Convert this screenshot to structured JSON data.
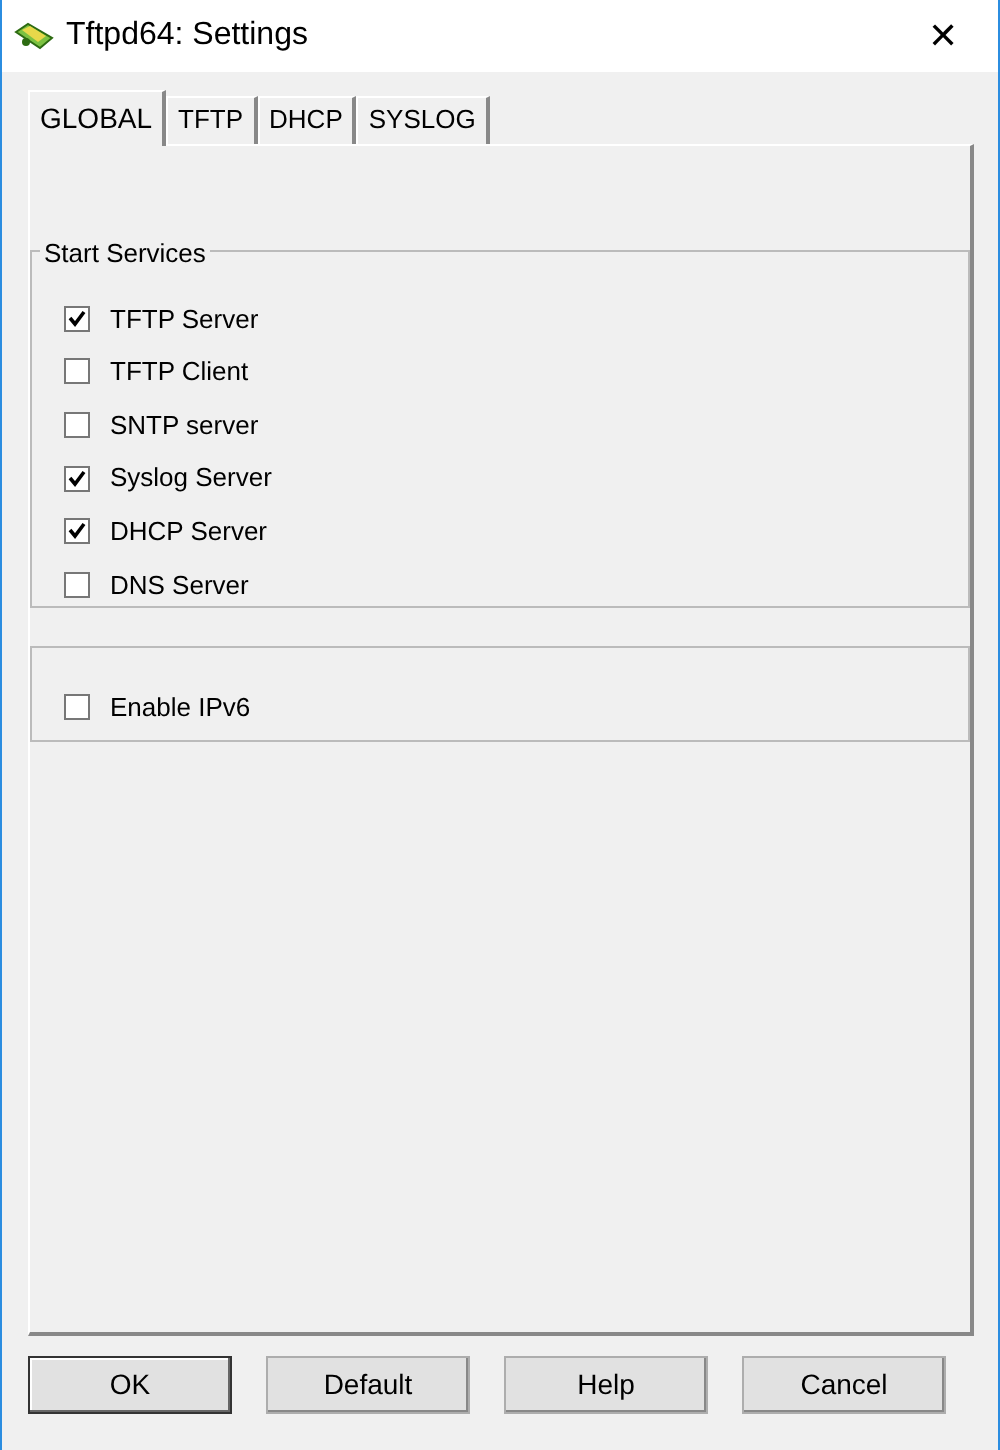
{
  "window": {
    "title": "Tftpd64: Settings",
    "close": "✕"
  },
  "tabs": [
    {
      "label": "GLOBAL",
      "selected": true
    },
    {
      "label": "TFTP",
      "selected": false
    },
    {
      "label": "DHCP",
      "selected": false
    },
    {
      "label": "SYSLOG",
      "selected": false
    }
  ],
  "start_services": {
    "title": "Start Services",
    "items": [
      {
        "label": "TFTP Server",
        "checked": true
      },
      {
        "label": "TFTP Client",
        "checked": false
      },
      {
        "label": "SNTP server",
        "checked": false
      },
      {
        "label": "Syslog Server",
        "checked": true
      },
      {
        "label": "DHCP Server",
        "checked": true
      },
      {
        "label": "DNS Server",
        "checked": false
      }
    ]
  },
  "ipv6": {
    "label": "Enable IPv6",
    "checked": false
  },
  "buttons": [
    {
      "label": "OK",
      "default": true
    },
    {
      "label": "Default",
      "default": false
    },
    {
      "label": "Help",
      "default": false
    },
    {
      "label": "Cancel",
      "default": false
    }
  ]
}
